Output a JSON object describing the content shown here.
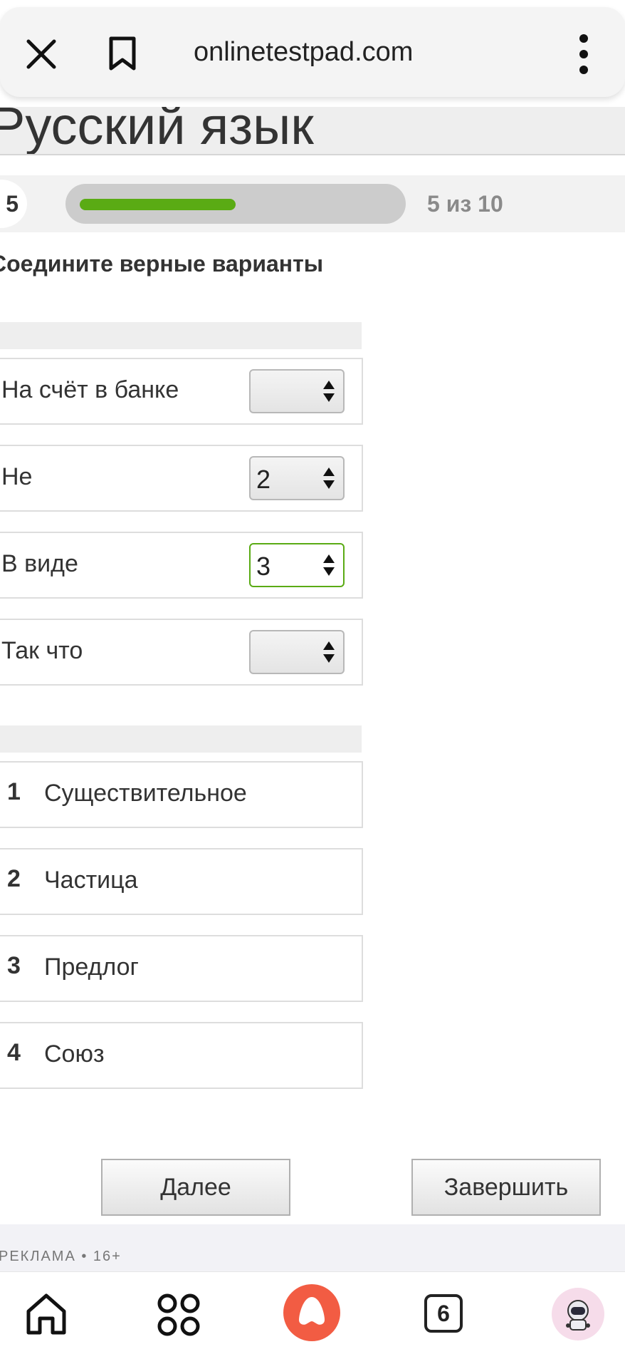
{
  "browser": {
    "url": "onlinetestpad.com",
    "close_icon": "close-icon",
    "bookmark_icon": "bookmark-icon",
    "menu_icon": "more-vertical-icon"
  },
  "page": {
    "title": "Русский язык"
  },
  "progress": {
    "current_number": "5",
    "text": "5 из 10",
    "fraction": 0.5,
    "color": "#5aab14"
  },
  "question": {
    "instruction": "Соедините верные варианты",
    "pairs": [
      {
        "label": "На счёт в банке",
        "value": ""
      },
      {
        "label": "Не",
        "value": "2"
      },
      {
        "label": "В виде",
        "value": "3"
      },
      {
        "label": "Так что",
        "value": ""
      }
    ],
    "options": [
      {
        "num": "1",
        "text": "Существительное"
      },
      {
        "num": "2",
        "text": "Частица"
      },
      {
        "num": "3",
        "text": "Предлог"
      },
      {
        "num": "4",
        "text": "Союз"
      }
    ]
  },
  "buttons": {
    "next": "Далее",
    "finish": "Завершить"
  },
  "ad": {
    "label": "РЕКЛАМА • 16+"
  },
  "bottom_nav": {
    "home_icon": "home-icon",
    "apps_icon": "apps-grid-icon",
    "assistant_icon": "alice-assistant-icon",
    "tabs_count": "6",
    "profile_icon": "astronaut-avatar-icon"
  }
}
